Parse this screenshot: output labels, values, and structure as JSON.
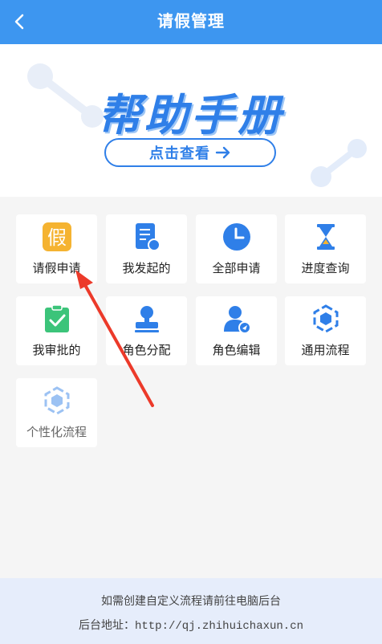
{
  "header": {
    "title": "请假管理",
    "back_icon": "chevron-left-icon"
  },
  "banner": {
    "title": "帮助手册",
    "button_label": "点击查看",
    "button_icon": "arrow-right-icon"
  },
  "menu": [
    {
      "label": "请假申请",
      "icon": "leave-badge-icon",
      "icon_text": "假",
      "muted": false
    },
    {
      "label": "我发起的",
      "icon": "document-icon",
      "muted": false
    },
    {
      "label": "全部申请",
      "icon": "clock-icon",
      "muted": false
    },
    {
      "label": "进度查询",
      "icon": "hourglass-icon",
      "muted": false
    },
    {
      "label": "我审批的",
      "icon": "clipboard-check-icon",
      "muted": false
    },
    {
      "label": "角色分配",
      "icon": "stamp-icon",
      "muted": false
    },
    {
      "label": "角色编辑",
      "icon": "user-edit-icon",
      "muted": false
    },
    {
      "label": "通用流程",
      "icon": "hexagon-flow-icon",
      "muted": false
    },
    {
      "label": "个性化流程",
      "icon": "hexagon-flow-icon",
      "muted": true
    }
  ],
  "footer": {
    "line1": "如需创建自定义流程请前往电脑后台",
    "line2": "后台地址：http://qj.zhihuichaxun.cn"
  },
  "colors": {
    "header": "#3d96f0",
    "accent": "#2f7fe8",
    "icon_orange": "#f5b331",
    "icon_green": "#3cc47a",
    "arrow_red": "#ec3a2a"
  }
}
